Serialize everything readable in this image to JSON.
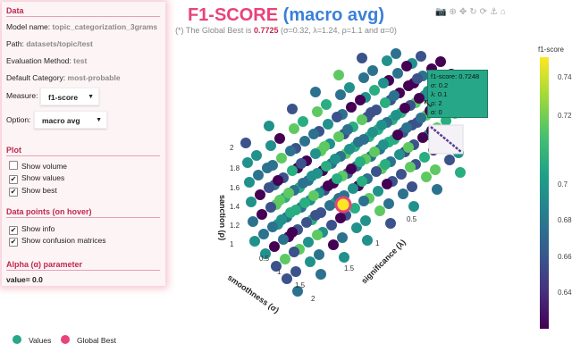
{
  "sidebar": {
    "data_title": "Data",
    "model_label": "Model name:",
    "model_value": "topic_categorization_3grams",
    "path_label": "Path:",
    "path_value": "datasets/topic/test",
    "eval_label": "Evaluation Method:",
    "eval_value": "test",
    "default_label": "Default Category:",
    "default_value": "most-probable",
    "measure_label": "Measure:",
    "measure_value": "f1-score",
    "option_label": "Option:",
    "option_value": "macro avg",
    "plot_title": "Plot",
    "show_volume": "Show volume",
    "show_values": "Show values",
    "show_best": "Show best",
    "datapoints_title": "Data points (on hover)",
    "show_info": "Show info",
    "show_confusion": "Show confusion matrices",
    "alpha_title": "Alpha (α) parameter",
    "alpha_value": "value= 0.0",
    "checks": {
      "volume": false,
      "values": true,
      "best": true,
      "info": true,
      "confusion": true
    }
  },
  "header": {
    "title_measure": "F1-SCORE",
    "title_option": "(macro avg)",
    "subtitle_prefix": "(*) The Global Best is ",
    "subtitle_best": "0.7725",
    "subtitle_params": " (σ=0.32, λ=1.24, ρ=1.1 and α=0)"
  },
  "hover_info": {
    "line1": "f1-score: 0.7248",
    "line2": "σ: 0.2",
    "line3": "λ: 0.1",
    "line4": "ρ: 2",
    "line5": "α: 0"
  },
  "legend": {
    "values": "Values",
    "best": "Global Best"
  },
  "colorbar": {
    "title": "f1-score",
    "ticks": [
      "0.74",
      "0.72",
      "0.7",
      "0.68",
      "0.66",
      "0.64"
    ]
  },
  "colors": {
    "accent": "#c0284d",
    "best": "#e8437a",
    "value": "#26a888"
  },
  "icons": [
    "camera-icon",
    "zoom-icon",
    "pan-icon",
    "orbit-icon",
    "turntable-icon",
    "reset-icon",
    "home-icon"
  ],
  "chart_data": {
    "type": "scatter",
    "axes": {
      "x_label": "smoothness (σ)",
      "y_label": "significance (λ)",
      "z_label": "sanction (ρ)",
      "x_ticks": [
        "0.5",
        "1",
        "1.5",
        "2"
      ],
      "y_ticks": [
        "0.5",
        "1",
        "1.5"
      ],
      "z_ticks": [
        "1",
        "1.2",
        "1.4",
        "1.6",
        "1.8",
        "2"
      ]
    },
    "global_best": {
      "sigma": 0.32,
      "lambda": 1.24,
      "rho": 1.1,
      "value": 0.7725
    },
    "color_range": [
      0.63,
      0.78
    ]
  }
}
